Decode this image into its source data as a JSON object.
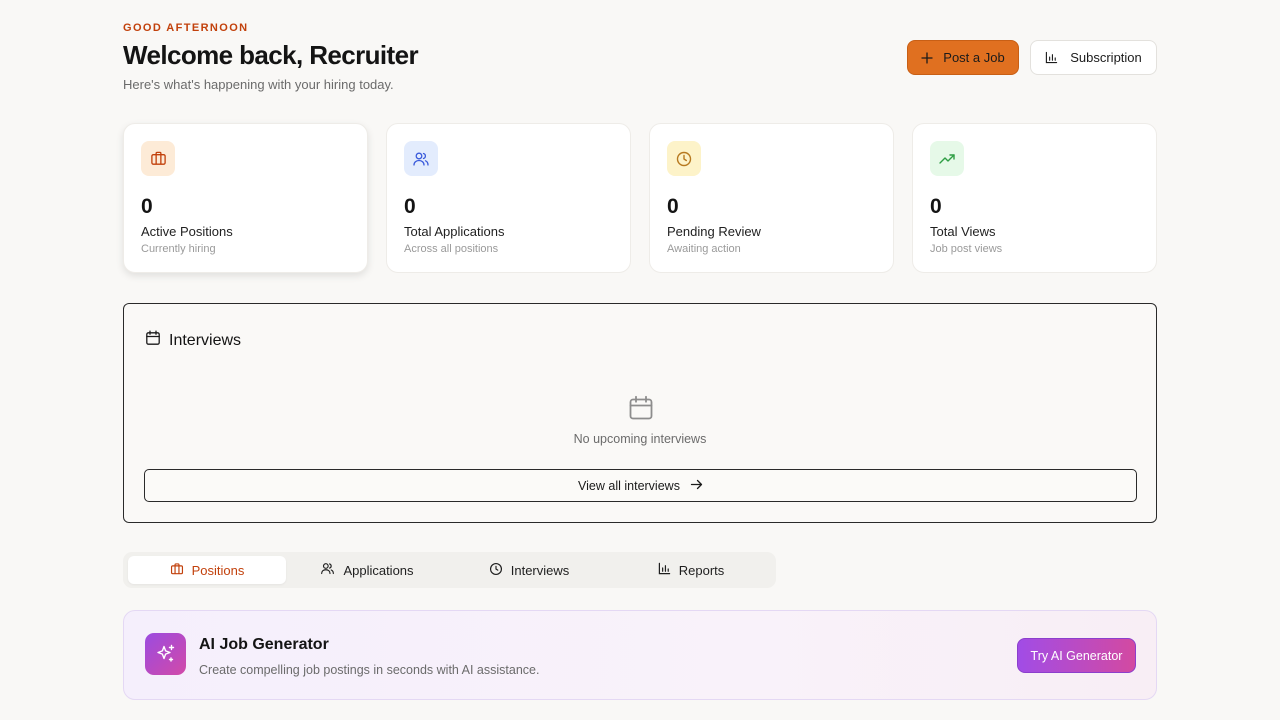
{
  "header": {
    "greeting": "GOOD AFTERNOON",
    "title": "Welcome back, Recruiter",
    "subtitle": "Here's what's happening with your hiring today.",
    "post_job_label": "Post a Job",
    "subscription_label": "Subscription"
  },
  "stats": [
    {
      "icon": "briefcase-icon",
      "value": "0",
      "label": "Active Positions",
      "sub": "Currently hiring",
      "accent": "#c2410c",
      "bg": "#fdebd7"
    },
    {
      "icon": "users-icon",
      "value": "0",
      "label": "Total Applications",
      "sub": "Across all positions",
      "accent": "#3b5bdb",
      "bg": "#e3ecfd"
    },
    {
      "icon": "clock-icon",
      "value": "0",
      "label": "Pending Review",
      "sub": "Awaiting action",
      "accent": "#b7791f",
      "bg": "#fdf3c9"
    },
    {
      "icon": "trending-up-icon",
      "value": "0",
      "label": "Total Views",
      "sub": "Job post views",
      "accent": "#2f9e44",
      "bg": "#e6f9e8"
    }
  ],
  "interviews": {
    "title": "Interviews",
    "empty_text": "No upcoming interviews",
    "view_all_label": "View all interviews"
  },
  "tabs": [
    {
      "label": "Positions",
      "icon": "briefcase-icon",
      "active": true
    },
    {
      "label": "Applications",
      "icon": "users-icon",
      "active": false
    },
    {
      "label": "Interviews",
      "icon": "clock-icon",
      "active": false
    },
    {
      "label": "Reports",
      "icon": "bar-chart-icon",
      "active": false
    }
  ],
  "ai": {
    "title": "AI Job Generator",
    "subtitle": "Create compelling job postings in seconds with AI assistance.",
    "button_label": "Try AI Generator"
  },
  "colors": {
    "accent": "#e07020",
    "accent_text": "#c2410c",
    "ai_gradient_start": "#a14ce6",
    "ai_gradient_end": "#d34aa1"
  }
}
